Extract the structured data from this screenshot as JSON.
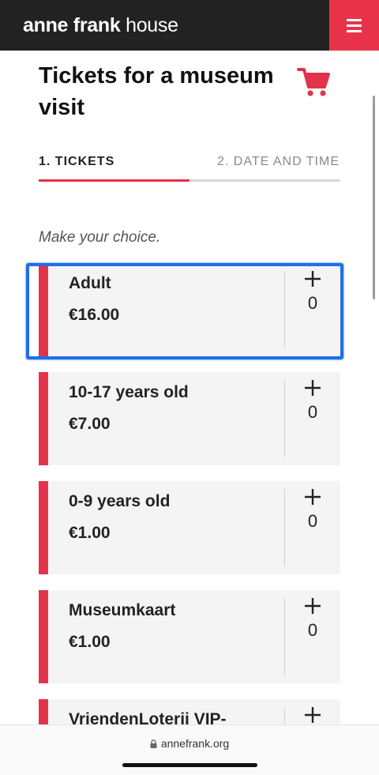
{
  "header": {
    "logo_bold": "anne frank",
    "logo_light": "house"
  },
  "page": {
    "title": "Tickets for a museum visit",
    "prompt": "Make your choice."
  },
  "steps": [
    {
      "label": "1. TICKETS",
      "active": true
    },
    {
      "label": "2. DATE AND TIME",
      "active": false
    }
  ],
  "step_progress": 0.5,
  "tickets": [
    {
      "name": "Adult",
      "price": "€16.00",
      "quantity": "0",
      "plus": "+"
    },
    {
      "name": "10-17 years old",
      "price": "€7.00",
      "quantity": "0",
      "plus": "+"
    },
    {
      "name": "0-9 years old",
      "price": "€1.00",
      "quantity": "0",
      "plus": "+"
    },
    {
      "name": "Museumkaart",
      "price": "€1.00",
      "quantity": "0",
      "plus": "+"
    },
    {
      "name": "VriendenLoterij VIP-",
      "price": "",
      "quantity": "",
      "plus": "+"
    }
  ],
  "browser": {
    "url": "annefrank.org"
  },
  "colors": {
    "accent": "#e2334a",
    "header_bg": "#222222",
    "card_bg": "#f4f4f4",
    "highlight": "#1f6fe8"
  }
}
